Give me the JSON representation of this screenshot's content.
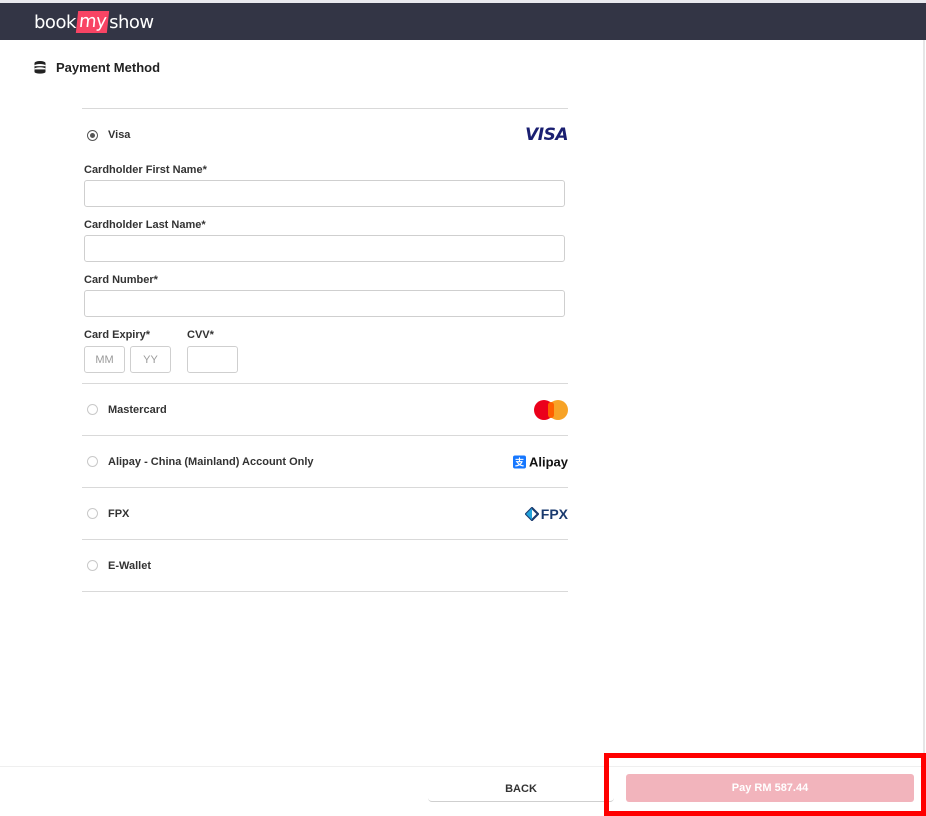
{
  "brand": {
    "part1": "book",
    "part2": "my",
    "part3": "show",
    "accent": "#f84464",
    "header_bg": "#333545"
  },
  "section": {
    "title": "Payment Method",
    "icon": "coins-icon"
  },
  "methods": [
    {
      "label": "Visa",
      "selected": true,
      "logo_text": "VISA"
    },
    {
      "label": "Mastercard",
      "selected": false,
      "logo_text": ""
    },
    {
      "label": "Alipay - China (Mainland) Account Only",
      "selected": false,
      "logo_text": "Alipay"
    },
    {
      "label": "FPX",
      "selected": false,
      "logo_text": "FPX"
    },
    {
      "label": "E-Wallet",
      "selected": false,
      "logo_text": ""
    }
  ],
  "form": {
    "first_name_label": "Cardholder First Name*",
    "last_name_label": "Cardholder Last Name*",
    "card_number_label": "Card Number*",
    "expiry_label": "Card Expiry*",
    "cvv_label": "CVV*",
    "mm_placeholder": "MM",
    "yy_placeholder": "YY"
  },
  "footer": {
    "back_label": "BACK",
    "pay_label": "Pay RM 587.44",
    "pay_color": "#f2b4bc"
  }
}
